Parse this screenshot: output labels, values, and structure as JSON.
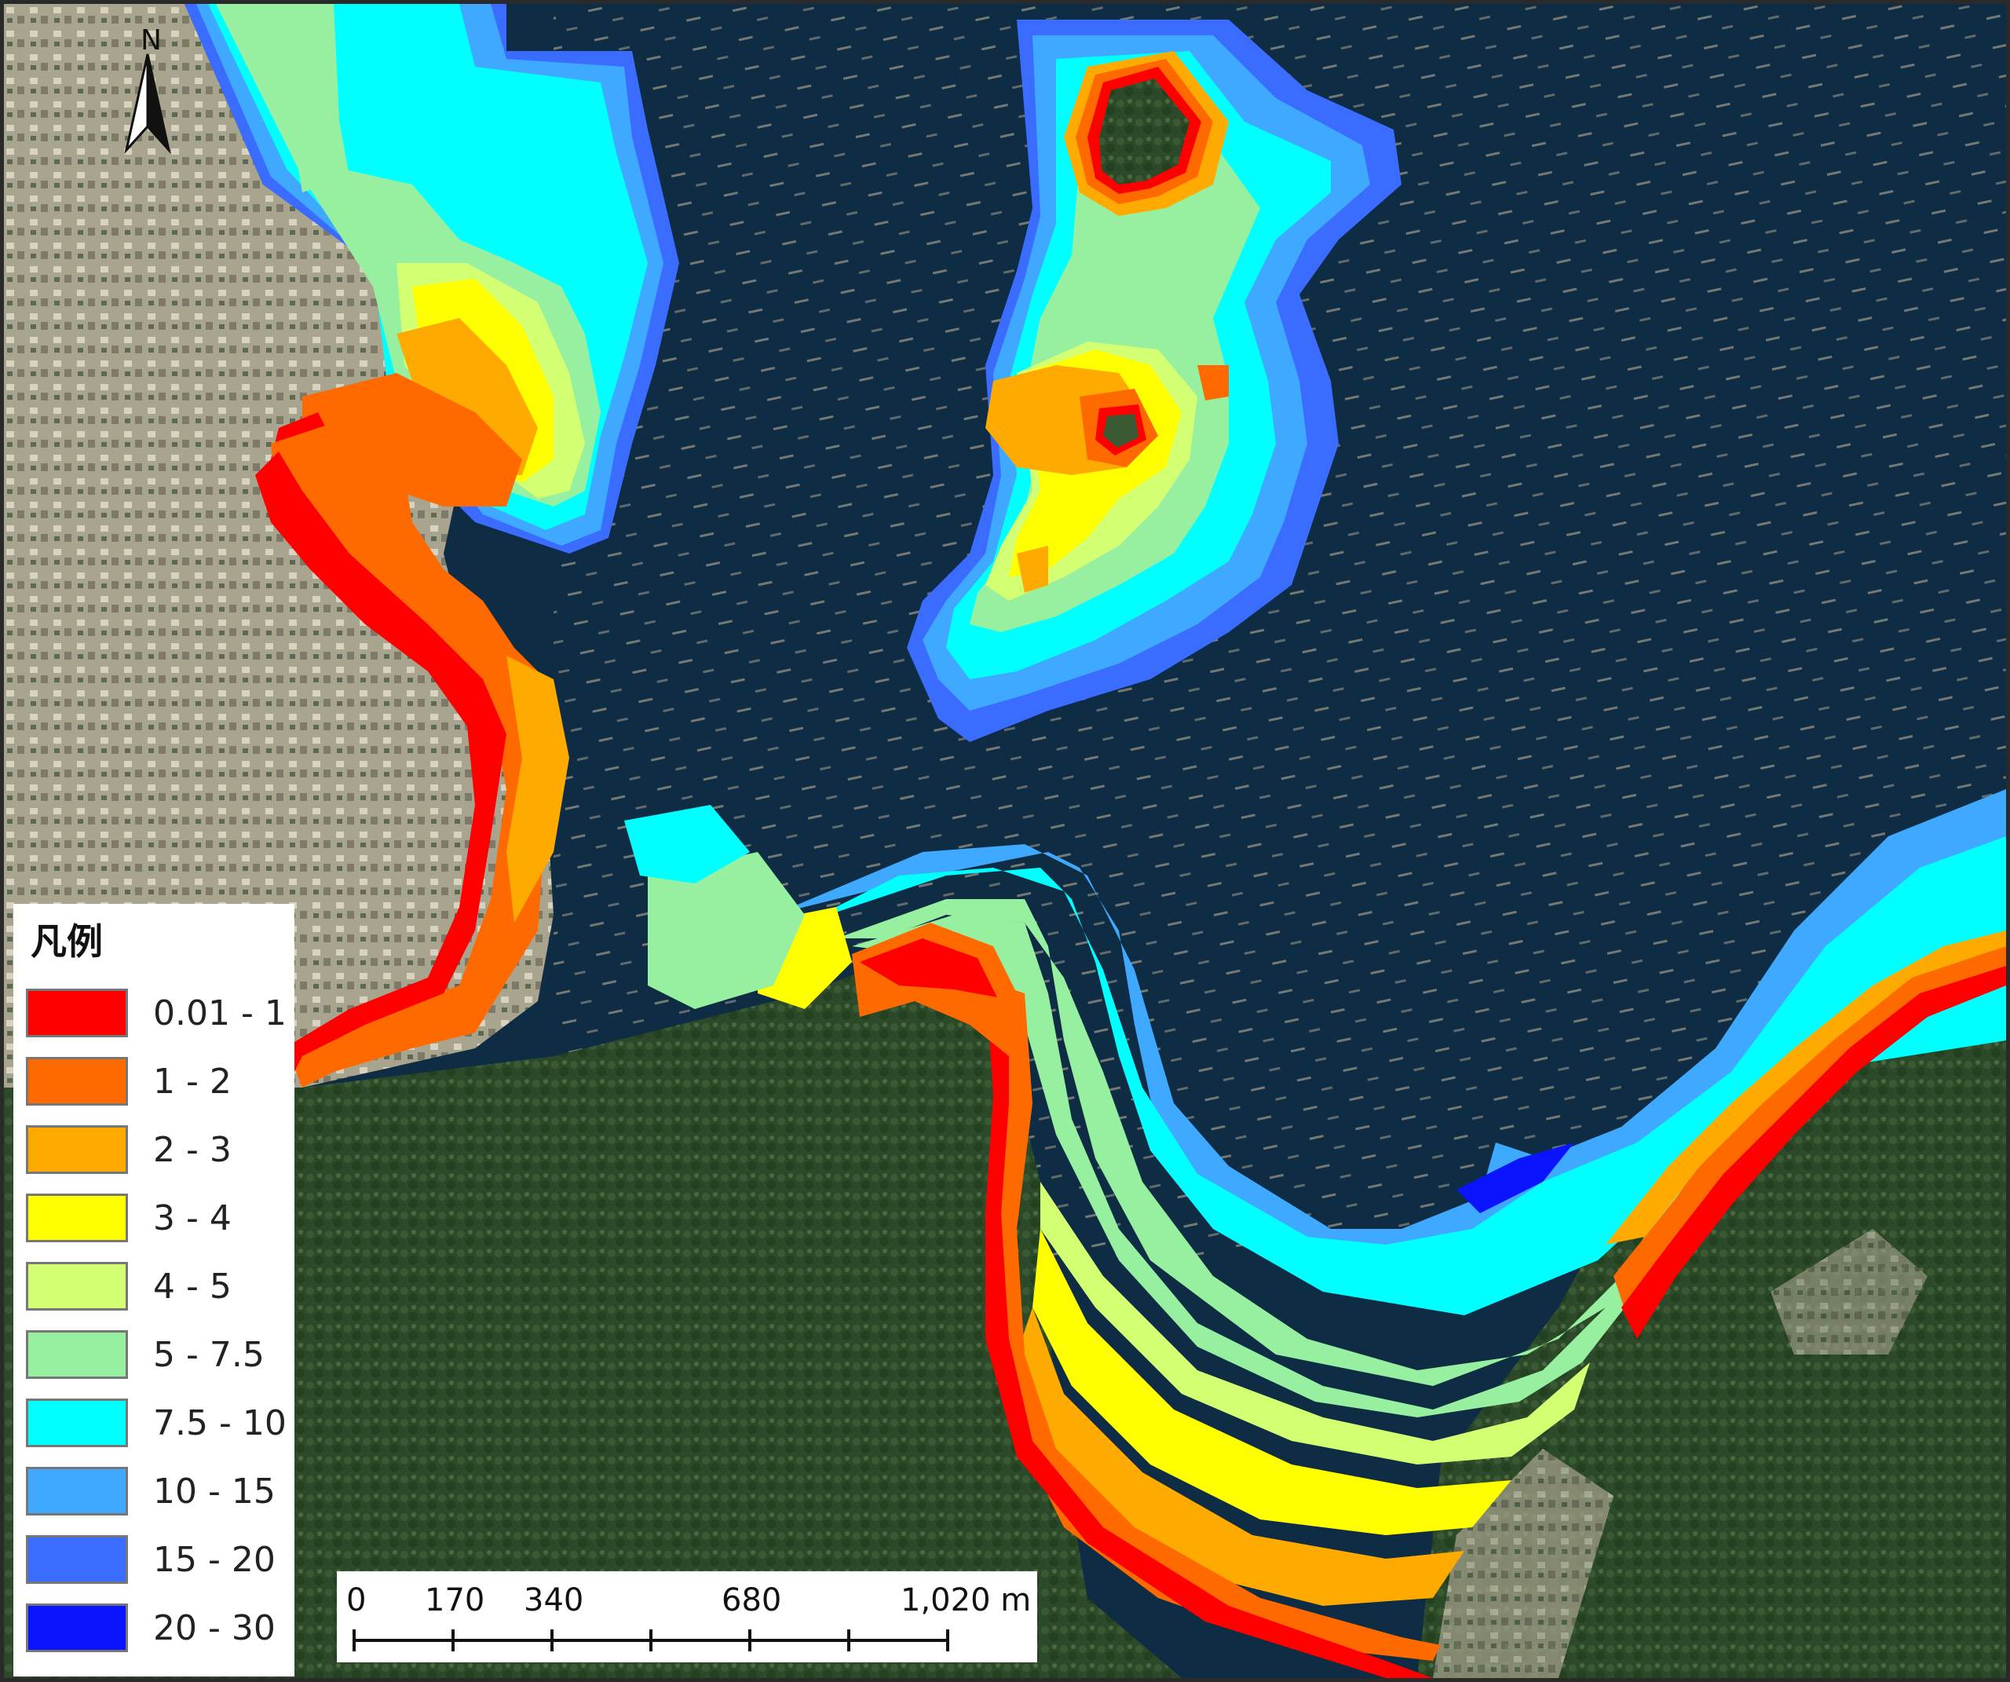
{
  "legend": {
    "title": "凡例",
    "items": [
      {
        "label": "0.01 - 1",
        "color": "#ff0000"
      },
      {
        "label": "1 - 2",
        "color": "#ff6a00"
      },
      {
        "label": "2 - 3",
        "color": "#ffaa00"
      },
      {
        "label": "3 - 4",
        "color": "#ffff00"
      },
      {
        "label": "4 - 5",
        "color": "#d3ff73"
      },
      {
        "label": "5 - 7.5",
        "color": "#96f0a0"
      },
      {
        "label": "7.5 - 10",
        "color": "#00ffff"
      },
      {
        "label": "10 - 15",
        "color": "#3fa9ff"
      },
      {
        "label": "15 - 20",
        "color": "#3a6cff"
      },
      {
        "label": "20 - 30",
        "color": "#0a14ff"
      }
    ]
  },
  "scale_bar": {
    "unit": "m",
    "ticks": [
      "0",
      "170",
      "340",
      "",
      "680",
      "",
      "1,020 m"
    ]
  },
  "north_arrow": {
    "label": "N",
    "icon": "north-arrow-icon"
  },
  "map_colors": {
    "sea": "#0f2c45",
    "land_forest": "#2f4a2c",
    "land_urban": "#b9b39c"
  }
}
